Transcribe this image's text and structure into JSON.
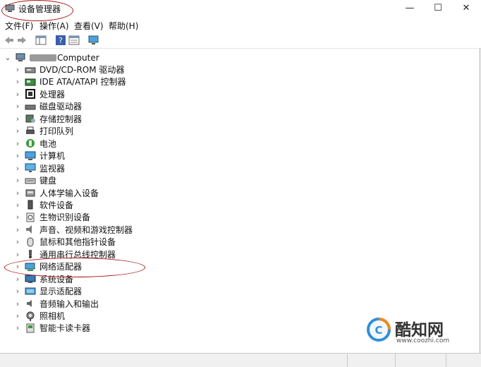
{
  "window": {
    "title": "设备管理器"
  },
  "controls": {
    "minimize": "—",
    "maximize": "☐",
    "close": "✕"
  },
  "menubar": [
    "文件(F)",
    "操作(A)",
    "查看(V)",
    "帮助(H)"
  ],
  "tree": {
    "root": "Computer",
    "root_chevron": "⌄",
    "chevron": "›",
    "items": [
      "DVD/CD-ROM 驱动器",
      "IDE ATA/ATAPI 控制器",
      "处理器",
      "磁盘驱动器",
      "存储控制器",
      "打印队列",
      "电池",
      "计算机",
      "监视器",
      "键盘",
      "人体学输入设备",
      "软件设备",
      "生物识别设备",
      "声音、视频和游戏控制器",
      "鼠标和其他指针设备",
      "通用串行总线控制器",
      "网络适配器",
      "系统设备",
      "显示适配器",
      "音频输入和输出",
      "照相机",
      "智能卡读卡器"
    ]
  },
  "watermark": {
    "brand": "酷知网",
    "url": "www.coozhi.com"
  },
  "accent": "#b01818"
}
